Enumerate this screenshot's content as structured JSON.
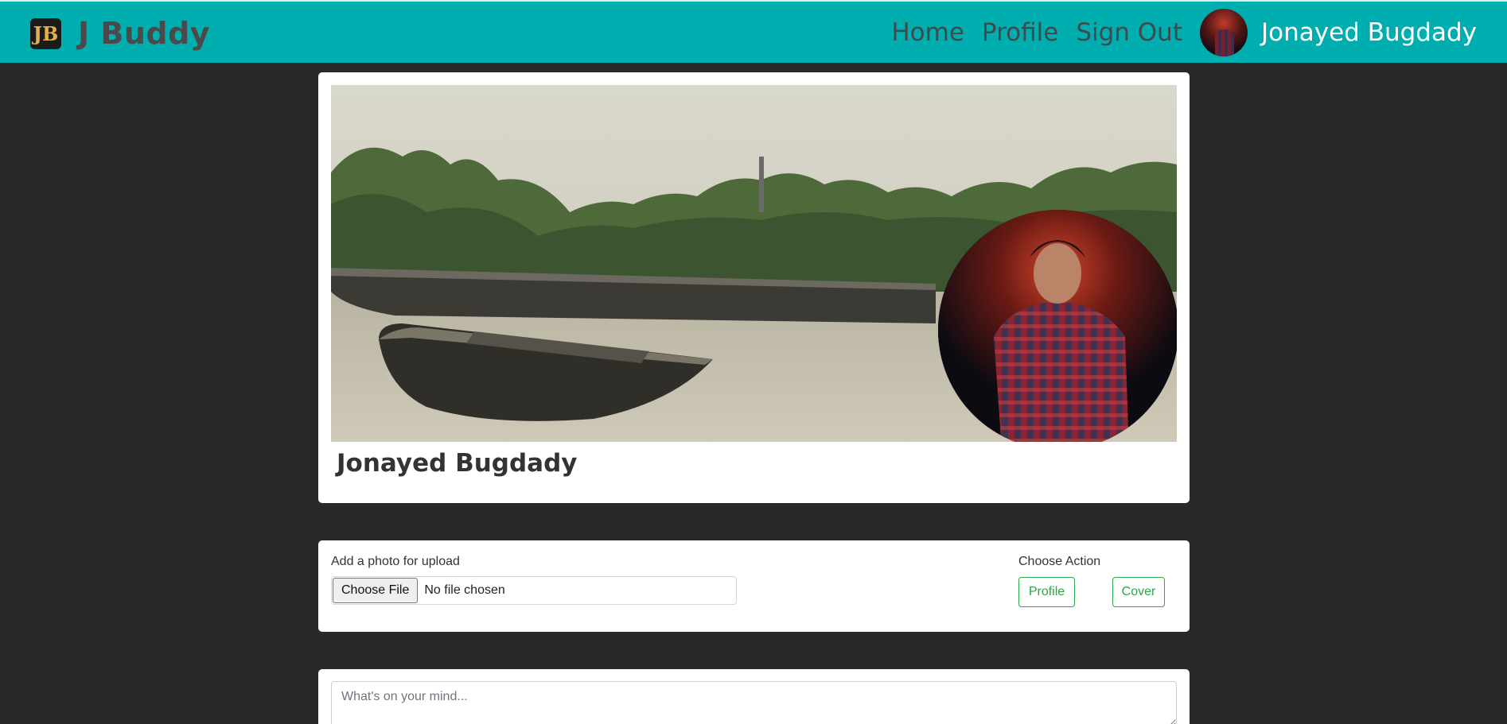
{
  "navbar": {
    "brand_logo_text": "JB",
    "brand_name": "J Buddy",
    "links": {
      "home": "Home",
      "profile": "Profile",
      "sign_out": "Sign Out"
    },
    "username": "Jonayed Bugdady",
    "accent_color": "#00aeb0"
  },
  "profile": {
    "name": "Jonayed Bugdady"
  },
  "upload": {
    "label": "Add a photo for upload",
    "file_button": "Choose File",
    "file_status": "No file chosen",
    "action_label": "Choose Action",
    "profile_button": "Profile",
    "cover_button": "Cover",
    "button_color": "#28a745"
  },
  "post": {
    "placeholder": "What's on your mind..."
  }
}
